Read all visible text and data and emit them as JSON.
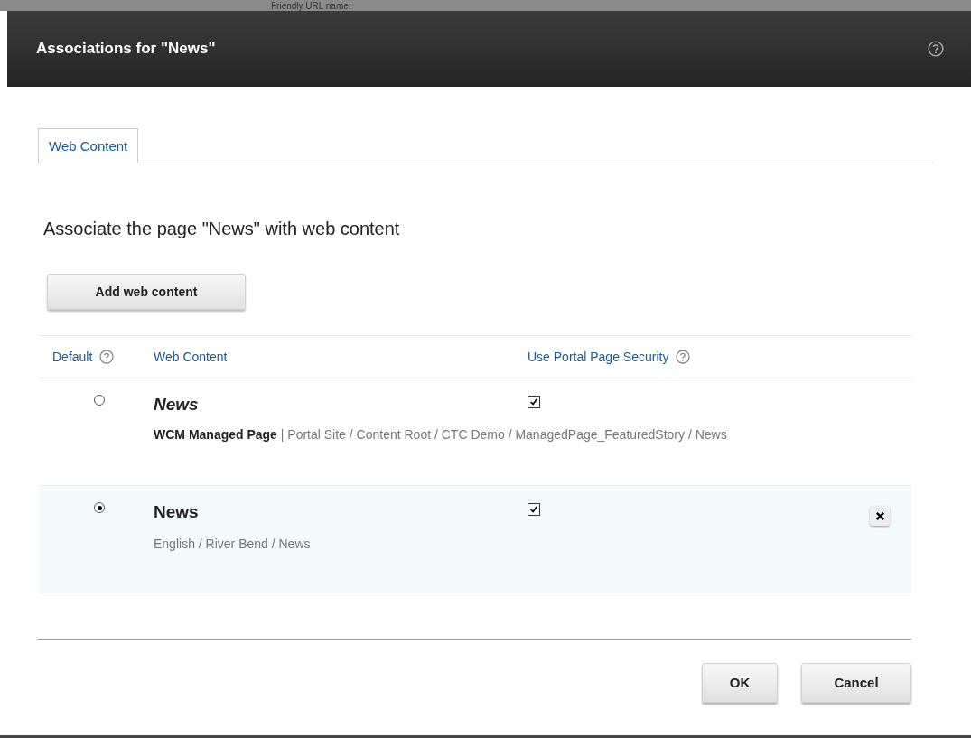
{
  "background_text": "Friendly URL name:",
  "dialog": {
    "title": "Associations for \"News\""
  },
  "tabs": [
    {
      "label": "Web Content",
      "selected": true
    }
  ],
  "heading": "Associate the page \"News\" with web content",
  "add_button": "Add web content",
  "table": {
    "columns": [
      {
        "label": "Default",
        "help": true
      },
      {
        "label": "Web Content",
        "help": false
      },
      {
        "label": "Use Portal Page Security",
        "help": true
      }
    ],
    "rows": [
      {
        "title": "News",
        "italic": true,
        "path": "**WCM Managed Page** | Portal Site / Content Root / CTC Demo / ManagedPage_FeaturedStory / News",
        "selected": false,
        "checked": true,
        "removable": false
      },
      {
        "title": "News",
        "italic": false,
        "path": "English / River Bend / News",
        "selected": true,
        "checked": true,
        "removable": true
      }
    ]
  },
  "buttons": [
    "OK",
    "Cancel"
  ]
}
